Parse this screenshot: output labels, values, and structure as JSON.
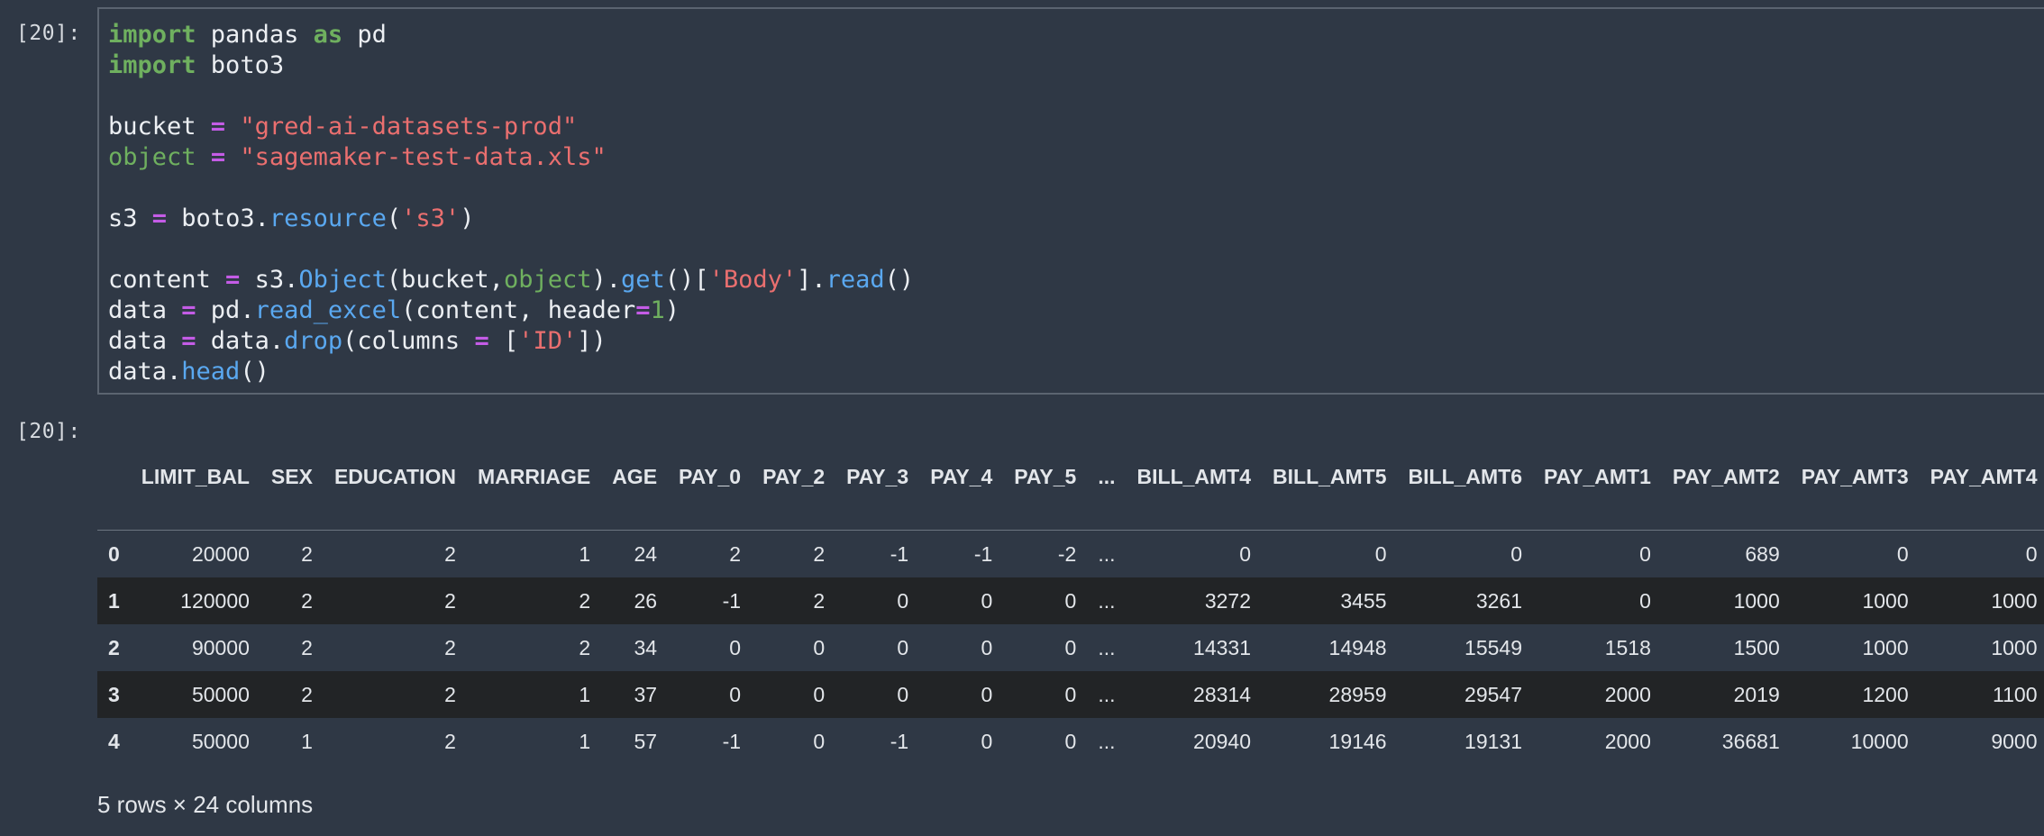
{
  "cell": {
    "input_prompt": "[20]:",
    "output_prompt": "[20]:",
    "code": {
      "l1": {
        "kw1": "import",
        "t1": " pandas ",
        "kw2": "as",
        "t2": " pd"
      },
      "l2": {
        "kw1": "import",
        "t1": " boto3"
      },
      "l3": {
        "t1": "bucket ",
        "op": "=",
        "t2": " ",
        "str": "\"gred-ai-datasets-prod\""
      },
      "l4": {
        "bi": "object",
        "t1": " ",
        "op": "=",
        "t2": " ",
        "str": "\"sagemaker-test-data.xls\""
      },
      "l5": {
        "t1": "s3 ",
        "op": "=",
        "t2": " boto3.",
        "fn": "resource",
        "t3": "(",
        "str": "'s3'",
        "t4": ")"
      },
      "l6": {
        "t1": "content ",
        "op": "=",
        "t2": " s3.",
        "fn1": "Object",
        "t3": "(bucket,",
        "bi": "object",
        "t4": ").",
        "fn2": "get",
        "t5": "()[",
        "str": "'Body'",
        "t6": "].",
        "fn3": "read",
        "t7": "()"
      },
      "l7": {
        "t1": "data ",
        "op1": "=",
        "t2": " pd.",
        "fn": "read_excel",
        "t3": "(content, header",
        "op2": "=",
        "num": "1",
        "t4": ")"
      },
      "l8": {
        "t1": "data ",
        "op1": "=",
        "t2": " data.",
        "fn": "drop",
        "t3": "(columns ",
        "op2": "=",
        "t4": " [",
        "str": "'ID'",
        "t5": "])"
      },
      "l9": {
        "t1": "data.",
        "fn": "head",
        "t2": "()"
      }
    }
  },
  "table": {
    "columns": [
      "",
      "LIMIT_BAL",
      "SEX",
      "EDUCATION",
      "MARRIAGE",
      "AGE",
      "PAY_0",
      "PAY_2",
      "PAY_3",
      "PAY_4",
      "PAY_5",
      "...",
      "BILL_AMT4",
      "BILL_AMT5",
      "BILL_AMT6",
      "PAY_AMT1",
      "PAY_AMT2",
      "PAY_AMT3",
      "PAY_AMT4"
    ],
    "rows": [
      [
        "0",
        "20000",
        "2",
        "2",
        "1",
        "24",
        "2",
        "2",
        "-1",
        "-1",
        "-2",
        "...",
        "0",
        "0",
        "0",
        "0",
        "689",
        "0",
        "0"
      ],
      [
        "1",
        "120000",
        "2",
        "2",
        "2",
        "26",
        "-1",
        "2",
        "0",
        "0",
        "0",
        "...",
        "3272",
        "3455",
        "3261",
        "0",
        "1000",
        "1000",
        "1000"
      ],
      [
        "2",
        "90000",
        "2",
        "2",
        "2",
        "34",
        "0",
        "0",
        "0",
        "0",
        "0",
        "...",
        "14331",
        "14948",
        "15549",
        "1518",
        "1500",
        "1000",
        "1000"
      ],
      [
        "3",
        "50000",
        "2",
        "2",
        "1",
        "37",
        "0",
        "0",
        "0",
        "0",
        "0",
        "...",
        "28314",
        "28959",
        "29547",
        "2000",
        "2019",
        "1200",
        "1100"
      ],
      [
        "4",
        "50000",
        "1",
        "2",
        "1",
        "57",
        "-1",
        "0",
        "-1",
        "0",
        "0",
        "...",
        "20940",
        "19146",
        "19131",
        "2000",
        "36681",
        "10000",
        "9000"
      ]
    ],
    "summary": "5 rows × 24 columns"
  },
  "colors": {
    "background": "#2f3845",
    "keyword": "#6fb05f",
    "operator": "#c45ce6",
    "string": "#ea6f6f",
    "function": "#5aa8f0",
    "striped_row": "#222426"
  }
}
